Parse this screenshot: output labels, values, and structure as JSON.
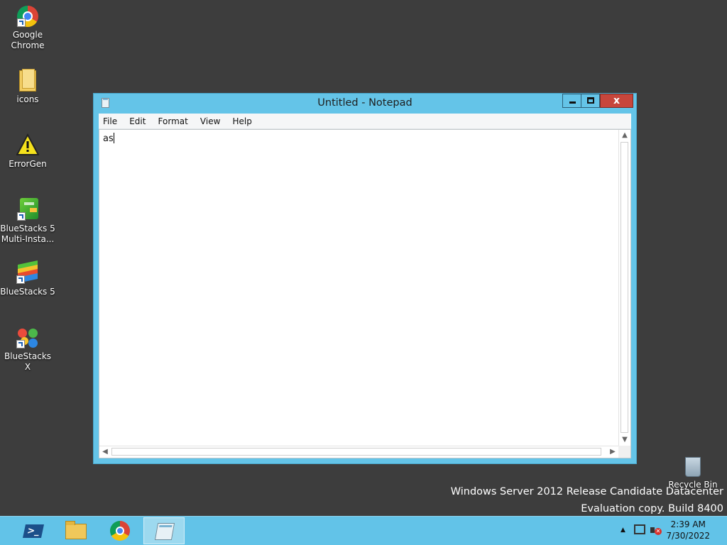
{
  "desktop": {
    "icons": [
      {
        "label_line1": "Google",
        "label_line2": "Chrome",
        "icon": "chrome-icon"
      },
      {
        "label_line1": "icons",
        "label_line2": "",
        "icon": "folder-icon"
      },
      {
        "label_line1": "ErrorGen",
        "label_line2": "",
        "icon": "warning-icon"
      },
      {
        "label_line1": "BlueStacks 5",
        "label_line2": "Multi-Insta...",
        "icon": "bluestacks-multi-instance-icon"
      },
      {
        "label_line1": "BlueStacks 5",
        "label_line2": "",
        "icon": "bluestacks-icon"
      },
      {
        "label_line1": "BlueStacks X",
        "label_line2": "",
        "icon": "bluestacks-x-icon"
      }
    ],
    "recycle_bin_label": "Recycle Bin",
    "watermark_line1": "Windows Server 2012 Release Candidate Datacenter",
    "watermark_line2": "Evaluation copy. Build 8400"
  },
  "notepad": {
    "title": "Untitled - Notepad",
    "controls": {
      "minimize": "minimize",
      "maximize": "maximize",
      "close": "x"
    },
    "menu": [
      "File",
      "Edit",
      "Format",
      "View",
      "Help"
    ],
    "content": "as"
  },
  "taskbar": {
    "apps": [
      "powershell-icon",
      "file-explorer-icon",
      "chrome-icon",
      "notepad-icon"
    ],
    "active_app": "notepad-icon",
    "clock_time": "2:39 AM",
    "clock_date": "7/30/2022"
  },
  "colors": {
    "desktop_bg": "#3d3d3d",
    "window_frame": "#64c4e8",
    "close_button": "#c7463c",
    "taskbar": "#62c3e8"
  }
}
